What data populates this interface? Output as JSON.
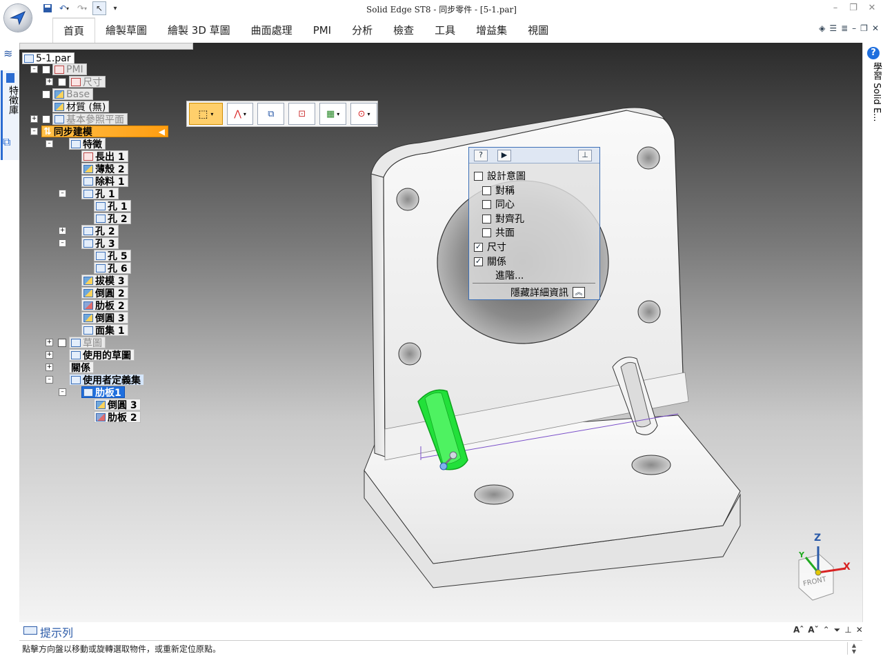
{
  "app": {
    "title": "Solid Edge ST8 - 同步零件 - [5-1.par]"
  },
  "ribbon": {
    "tabs": [
      "首頁",
      "繪製草圖",
      "繪製 3D 草圖",
      "曲面處理",
      "PMI",
      "分析",
      "檢查",
      "工具",
      "增益集",
      "視圖"
    ],
    "active_tab": "首頁"
  },
  "left_strip": {
    "tab_label": "特徵庫"
  },
  "right_strip": {
    "tab_label": "學習 Solid E..."
  },
  "tree": {
    "root": "5-1.par",
    "pmi": "PMI",
    "dimension": "尺寸",
    "base": "Base",
    "material": "材質 (無)",
    "ref_planes": "基本參照平面",
    "sync_modeling": "同步建模",
    "features": "特徵",
    "extrude": "長出 1",
    "thin_wall": "薄殼 2",
    "cutout": "除料 1",
    "hole1": "孔 1",
    "hole1_a": "孔 1",
    "hole1_b": "孔 2",
    "hole2": "孔 2",
    "hole3": "孔 3",
    "hole3_a": "孔 5",
    "hole3_b": "孔 6",
    "draft": "拔模 3",
    "round2": "倒圓 2",
    "rib2": "肋板 2",
    "round3": "倒圓 3",
    "face_set": "面集 1",
    "sketches": "草圖",
    "used_sketches": "使用的草圖",
    "relations": "關係",
    "user_sets": "使用者定義集",
    "rib1": "肋板1",
    "rib1_round": "倒圓 3",
    "rib1_rib": "肋板 2"
  },
  "intent_panel": {
    "design_intent": "設計意圖",
    "symmetric": "對稱",
    "concentric": "同心",
    "aligned_hole": "對齊孔",
    "coplanar": "共面",
    "dimensions": "尺寸",
    "relations": "關係",
    "advanced": "進階...",
    "hide_details": "隱藏詳細資訊",
    "checked": {
      "design_intent": false,
      "symmetric": false,
      "concentric": false,
      "aligned_hole": false,
      "coplanar": false,
      "dimensions": true,
      "relations": true
    }
  },
  "view_cube": {
    "z": "Z",
    "y": "Y",
    "x": "X",
    "face": "FRONT"
  },
  "prompt": {
    "title": "提示列",
    "message": "點擊方向盤以移動或旋轉選取物件，或重新定位原點。"
  },
  "colors": {
    "selection_green": "#22e03a",
    "tree_highlight": "#ff9d10",
    "selected_blue": "#1f6fde"
  }
}
